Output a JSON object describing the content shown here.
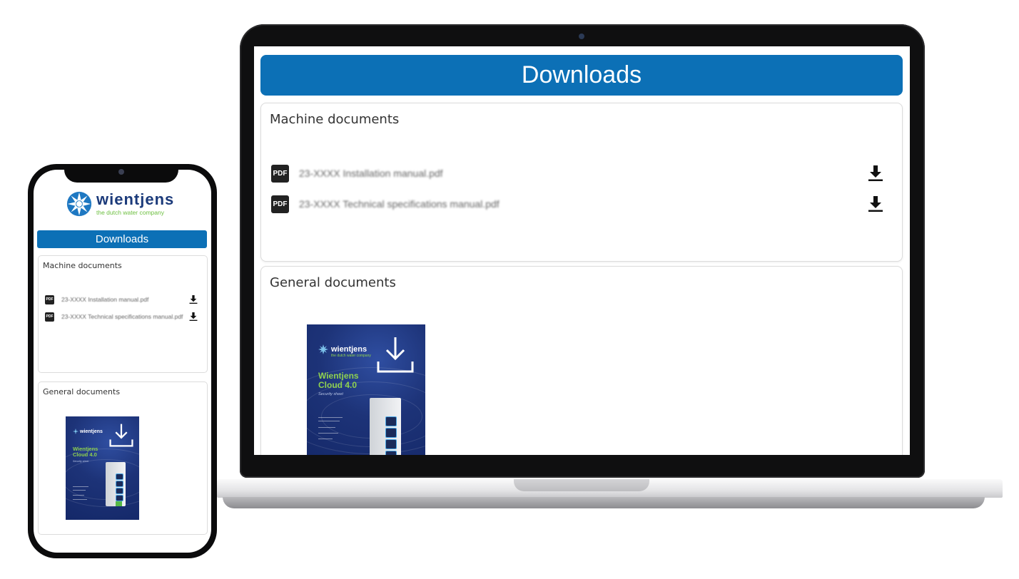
{
  "page": {
    "title": "Downloads",
    "accent_color": "#0c70b6"
  },
  "sections": {
    "machine": {
      "title": "Machine documents",
      "documents": [
        {
          "name": "23-XXXX Installation manual.pdf",
          "icon": "pdf-icon",
          "action_icon": "download-icon"
        },
        {
          "name": "23-XXXX Technical specifications manual.pdf",
          "icon": "pdf-icon",
          "action_icon": "download-icon"
        }
      ]
    },
    "general": {
      "title": "General documents",
      "brochure": {
        "brand": "wientjens",
        "brand_tagline": "the dutch water company",
        "title_line1": "Wientjens",
        "title_line2": "Cloud 4.0",
        "subtitle": "Security sheet",
        "icon": "download-icon"
      }
    }
  },
  "mobile": {
    "logo_word": "wientjens",
    "logo_tagline": "the dutch water company"
  },
  "labels": {
    "pdf_badge": "PDF"
  }
}
